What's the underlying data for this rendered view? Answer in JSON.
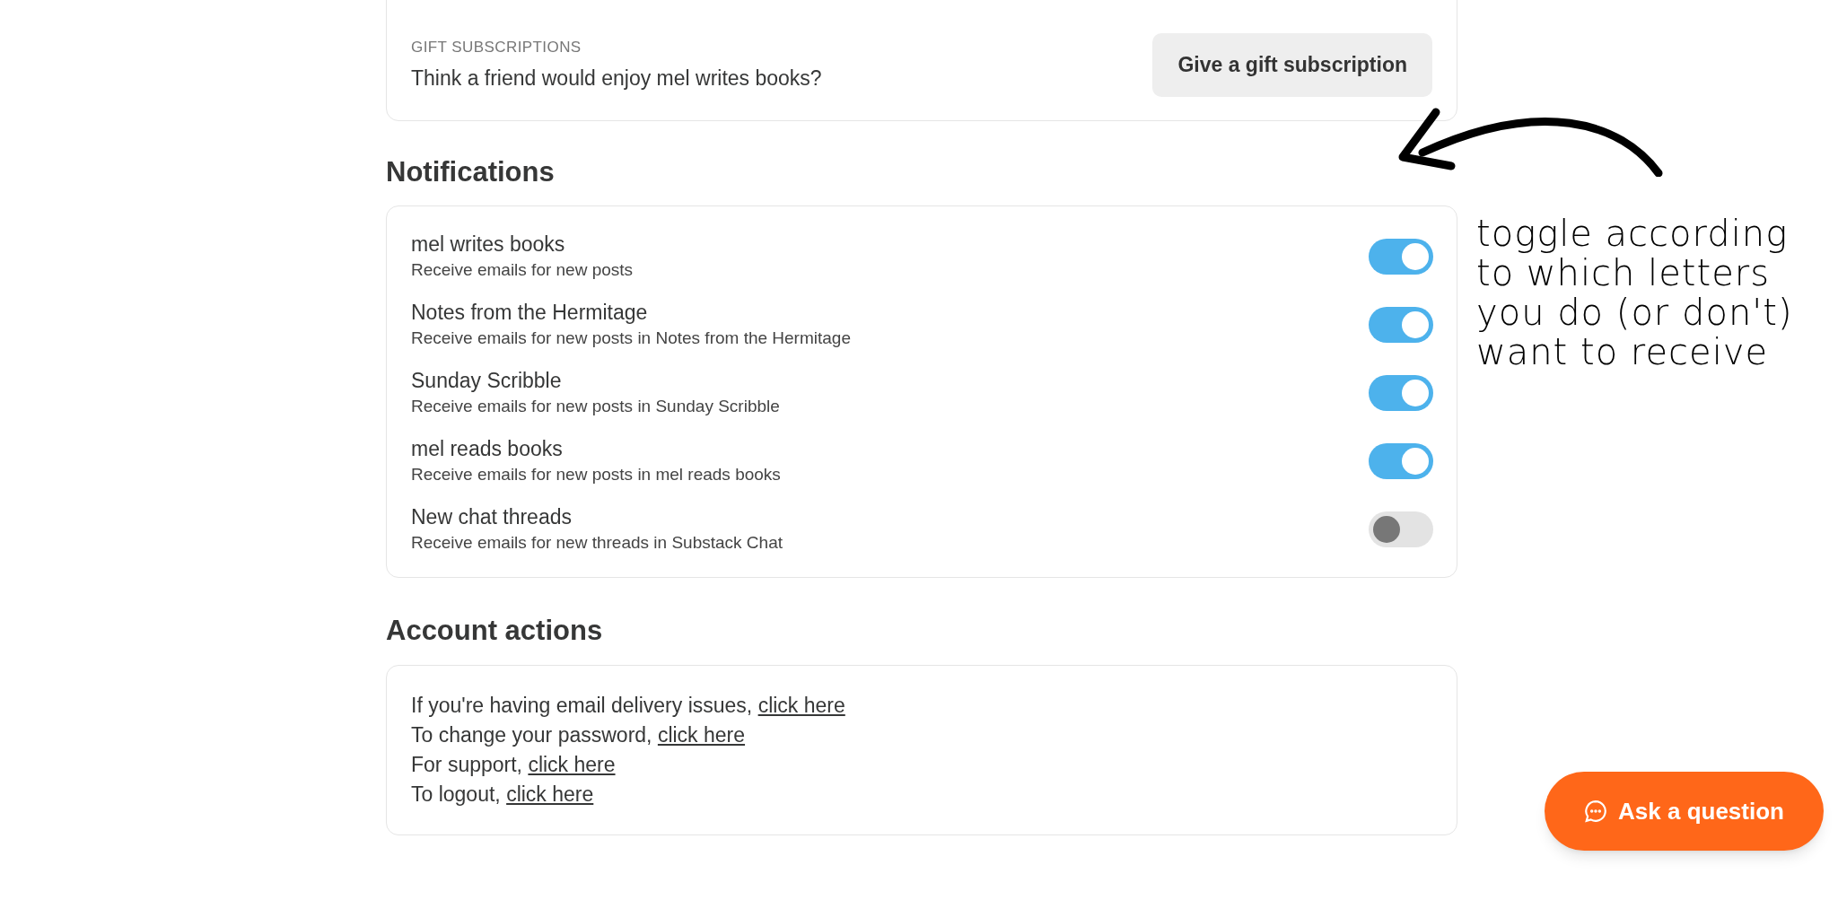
{
  "gift_subscriptions": {
    "label": "GIFT SUBSCRIPTIONS",
    "text": "Think a friend would enjoy mel writes books?",
    "button": "Give a gift subscription"
  },
  "notifications": {
    "heading": "Notifications",
    "items": [
      {
        "title": "mel writes books",
        "subtitle": "Receive emails for new posts",
        "on": true
      },
      {
        "title": "Notes from the Hermitage",
        "subtitle": "Receive emails for new posts in Notes from the Hermitage",
        "on": true
      },
      {
        "title": "Sunday Scribble",
        "subtitle": "Receive emails for new posts in Sunday Scribble",
        "on": true
      },
      {
        "title": "mel reads books",
        "subtitle": "Receive emails for new posts in mel reads books",
        "on": true
      },
      {
        "title": "New chat threads",
        "subtitle": "Receive emails for new threads in Substack Chat",
        "on": false
      }
    ]
  },
  "account_actions": {
    "heading": "Account actions",
    "items": [
      {
        "text": "If you're having email delivery issues,",
        "link": "click here"
      },
      {
        "text": "To change your password,",
        "link": "click here"
      },
      {
        "text": "For support,",
        "link": "click here"
      },
      {
        "text": "To logout,",
        "link": "click here"
      }
    ]
  },
  "annotation": {
    "lines": [
      "toggle according",
      "to which letters",
      "you do (or don't)",
      "want to receive"
    ]
  },
  "chat_button": {
    "label": "Ask a question"
  }
}
